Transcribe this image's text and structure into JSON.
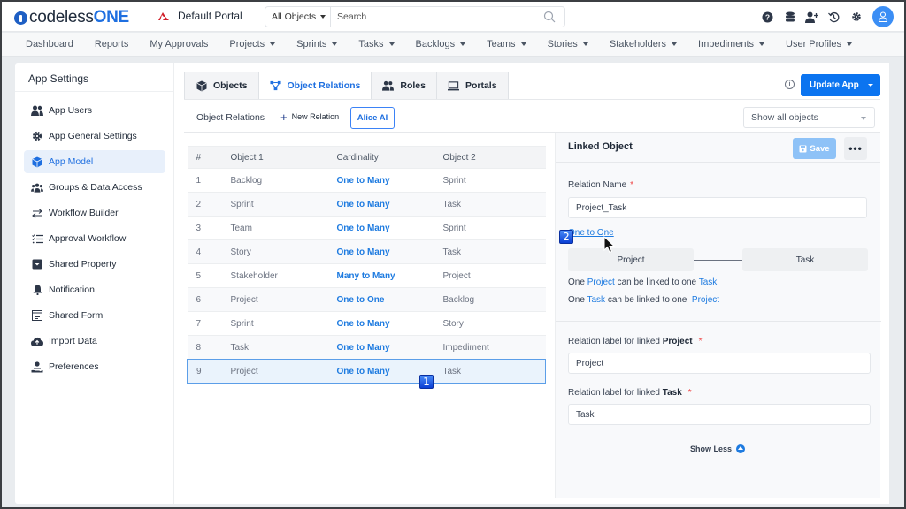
{
  "header": {
    "logo_prefix": "codeless",
    "logo_suffix": "ONE",
    "portal_name": "Default Portal",
    "search_scope": "All Objects",
    "search_placeholder": "Search",
    "icons": [
      "help-icon",
      "database-icon",
      "add-user-icon",
      "history-icon",
      "settings-icon",
      "user-avatar-icon"
    ]
  },
  "nav": {
    "items": [
      {
        "label": "Dashboard",
        "dropdown": false
      },
      {
        "label": "Reports",
        "dropdown": false
      },
      {
        "label": "My Approvals",
        "dropdown": false
      },
      {
        "label": "Projects",
        "dropdown": true
      },
      {
        "label": "Sprints",
        "dropdown": true
      },
      {
        "label": "Tasks",
        "dropdown": true
      },
      {
        "label": "Backlogs",
        "dropdown": true
      },
      {
        "label": "Teams",
        "dropdown": true
      },
      {
        "label": "Stories",
        "dropdown": true
      },
      {
        "label": "Stakeholders",
        "dropdown": true
      },
      {
        "label": "Impediments",
        "dropdown": true
      },
      {
        "label": "User Profiles",
        "dropdown": true
      }
    ]
  },
  "sidebar": {
    "title": "App Settings",
    "items": [
      {
        "label": "App Users",
        "icon": "users-icon"
      },
      {
        "label": "App General Settings",
        "icon": "gear-icon"
      },
      {
        "label": "App Model",
        "icon": "cube-icon",
        "active": true
      },
      {
        "label": "Groups & Data Access",
        "icon": "groups-icon"
      },
      {
        "label": "Workflow Builder",
        "icon": "exchange-icon"
      },
      {
        "label": "Approval Workflow",
        "icon": "checklist-icon"
      },
      {
        "label": "Shared Property",
        "icon": "inbox-icon"
      },
      {
        "label": "Notification",
        "icon": "bell-icon"
      },
      {
        "label": "Shared Form",
        "icon": "form-icon"
      },
      {
        "label": "Import Data",
        "icon": "cloud-upload-icon"
      },
      {
        "label": "Preferences",
        "icon": "preferences-icon"
      }
    ]
  },
  "main": {
    "tabs": [
      {
        "label": "Objects",
        "icon": "cube-icon"
      },
      {
        "label": "Object Relations",
        "icon": "relations-icon",
        "active": true
      },
      {
        "label": "Roles",
        "icon": "users-icon"
      },
      {
        "label": "Portals",
        "icon": "laptop-icon"
      }
    ],
    "update_app_label": "Update App",
    "section_label": "Object Relations",
    "new_relation_label": "New Relation",
    "alice_label": "Alice AI",
    "filter_value": "Show all objects",
    "accent_color": "#0b74f0"
  },
  "table": {
    "columns": [
      "#",
      "Object 1",
      "Cardinality",
      "Object 2"
    ],
    "rows": [
      {
        "n": "1",
        "object1": "Backlog",
        "cardinality": "One to Many",
        "object2": "Sprint"
      },
      {
        "n": "2",
        "object1": "Sprint",
        "cardinality": "One to Many",
        "object2": "Task"
      },
      {
        "n": "3",
        "object1": "Team",
        "cardinality": "One to Many",
        "object2": "Sprint"
      },
      {
        "n": "4",
        "object1": "Story",
        "cardinality": "One to Many",
        "object2": "Task"
      },
      {
        "n": "5",
        "object1": "Stakeholder",
        "cardinality": "Many to Many",
        "object2": "Project"
      },
      {
        "n": "6",
        "object1": "Project",
        "cardinality": "One to One",
        "object2": "Backlog"
      },
      {
        "n": "7",
        "object1": "Sprint",
        "cardinality": "One to Many",
        "object2": "Story"
      },
      {
        "n": "8",
        "object1": "Task",
        "cardinality": "One to Many",
        "object2": "Impediment"
      },
      {
        "n": "9",
        "object1": "Project",
        "cardinality": "One to Many",
        "object2": "Task",
        "selected": true
      }
    ]
  },
  "panel": {
    "title": "Linked Object",
    "save_label": "Save",
    "more_label": "•••",
    "relation_name_label": "Relation Name",
    "relation_name_value": "Project_Task",
    "cardinality_link": "One to One",
    "left_object": "Project",
    "right_object": "Task",
    "sentence1": {
      "pre": "One ",
      "a": "Project",
      "mid": " can be linked to one ",
      "b": "Task"
    },
    "sentence2": {
      "pre": "One ",
      "a": "Task",
      "mid": " can be linked to one ",
      "b": "Project"
    },
    "label_project_prefix": "Relation label for linked ",
    "label_project_bold": "Project",
    "label_project_value": "Project",
    "label_task_prefix": "Relation label for linked ",
    "label_task_bold": "Task",
    "label_task_value": "Task",
    "required_mark": "*",
    "show_less_label": "Show Less"
  },
  "annotations": {
    "badge1": "1",
    "badge2": "2"
  }
}
